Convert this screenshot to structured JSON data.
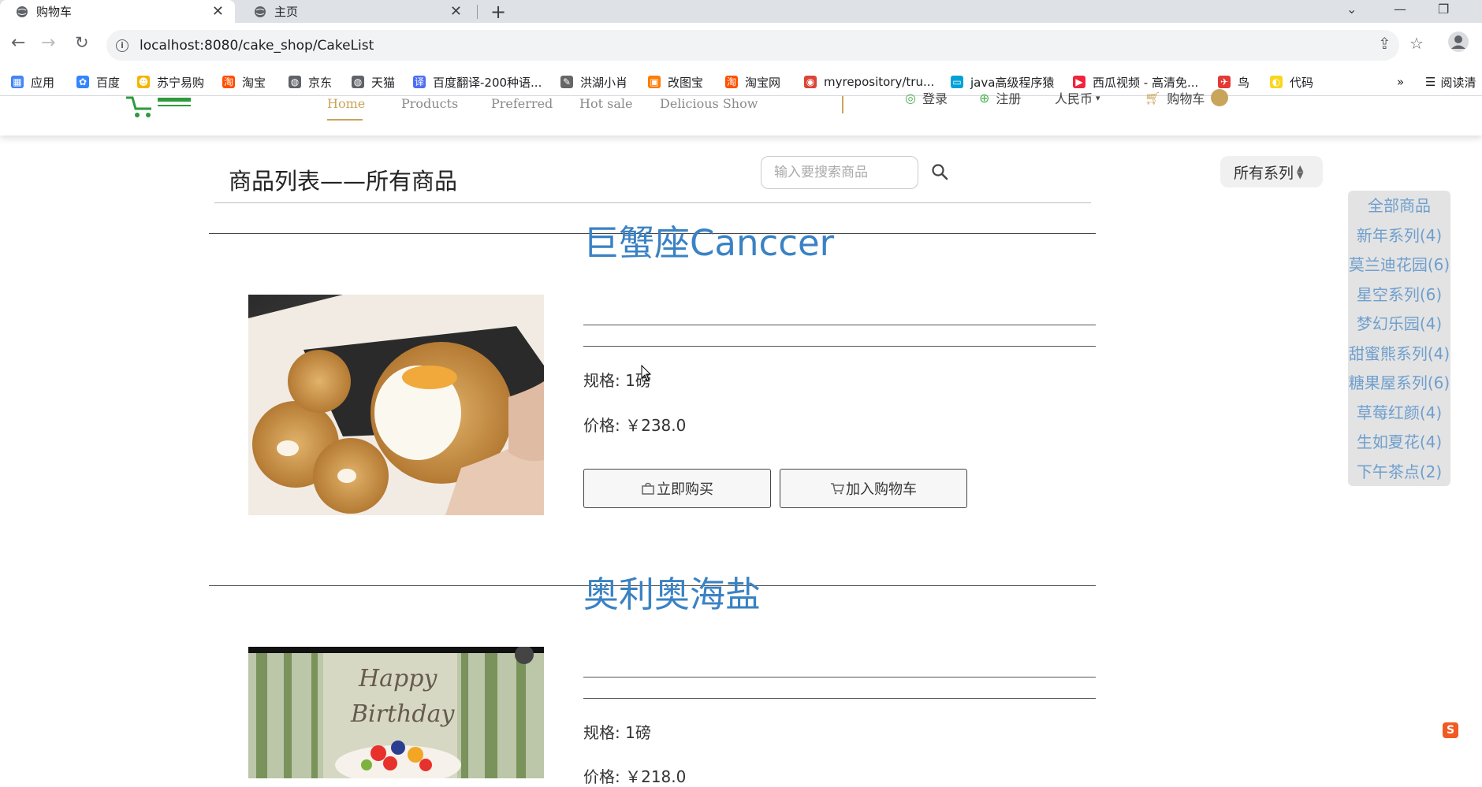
{
  "browser": {
    "tabs": [
      {
        "title": "购物车",
        "active": true
      },
      {
        "title": "主页",
        "active": false
      }
    ],
    "url": "localhost:8080/cake_shop/CakeList",
    "bookmarks": [
      {
        "label": "应用",
        "icon": "apps-grid-icon",
        "color": "#4285f4"
      },
      {
        "label": "百度",
        "icon": "baidu-paw-icon",
        "color": "#3385ff"
      },
      {
        "label": "苏宁易购",
        "icon": "suning-lion-icon",
        "color": "#f5b400"
      },
      {
        "label": "淘宝",
        "icon": "taobao-icon",
        "color": "#ff5000"
      },
      {
        "label": "京东",
        "icon": "globe-icon",
        "color": "#5f6368"
      },
      {
        "label": "天猫",
        "icon": "globe-icon",
        "color": "#5f6368"
      },
      {
        "label": "百度翻译-200种语...",
        "icon": "translate-icon",
        "color": "#4e6ef2"
      },
      {
        "label": "洪湖小肖",
        "icon": "feather-icon",
        "color": "#666666"
      },
      {
        "label": "改图宝",
        "icon": "image-edit-icon",
        "color": "#ff7a00"
      },
      {
        "label": "淘宝网",
        "icon": "taobao-icon",
        "color": "#ff5000"
      },
      {
        "label": "myrepository/tru...",
        "icon": "chrome-icon",
        "color": "#db4437"
      },
      {
        "label": "java高级程序猿",
        "icon": "bilibili-icon",
        "color": "#00a1d6"
      },
      {
        "label": "西瓜视频 - 高清免...",
        "icon": "xigua-play-icon",
        "color": "#f0253d"
      },
      {
        "label": "鸟",
        "icon": "bird-icon",
        "color": "#e53935"
      },
      {
        "label": "代码",
        "icon": "code-icon",
        "color": "#f9d71c"
      }
    ],
    "bookmarks_more": "»",
    "reading_list": "阅读清"
  },
  "header": {
    "menu": [
      {
        "label": "Home",
        "active": true
      },
      {
        "label": "Products",
        "active": false
      },
      {
        "label": "Preferred",
        "active": false
      },
      {
        "label": "Hot sale",
        "active": false
      },
      {
        "label": "Delicious Show",
        "active": false
      }
    ],
    "right_links": [
      {
        "label": "登录",
        "icon": "user-circle-icon"
      },
      {
        "label": "注册",
        "icon": "user-add-icon"
      },
      {
        "label": "人民币",
        "icon": "chevron-down-icon"
      },
      {
        "label": "购物车",
        "icon": "cart-icon"
      }
    ]
  },
  "list": {
    "title": "商品列表——所有商品",
    "search_placeholder": "输入要搜索商品",
    "series_select": "所有系列"
  },
  "categories": [
    "全部商品",
    "新年系列(4)",
    "莫兰迪花园(6)",
    "星空系列(6)",
    "梦幻乐园(4)",
    "甜蜜熊系列(4)",
    "糖果屋系列(6)",
    "草莓红颜(4)",
    "生如夏花(4)",
    "下午茶点(2)"
  ],
  "products": [
    {
      "name": "巨蟹座Canccer",
      "spec_label": "规格:",
      "spec_value": "1磅",
      "price_label": "价格:",
      "price_value": "￥238.0",
      "buy_now": "立即购买",
      "add_cart": "加入购物车"
    },
    {
      "name": "奥利奥海盐",
      "spec_label": "规格:",
      "spec_value": "1磅",
      "price_label": "价格:",
      "price_value": "￥218.0"
    }
  ],
  "colors": {
    "accent_gold": "#c9a45b",
    "product_name_blue": "#3a82c4",
    "category_blue": "#6e9fce",
    "logo_green": "#2e9a3c"
  }
}
